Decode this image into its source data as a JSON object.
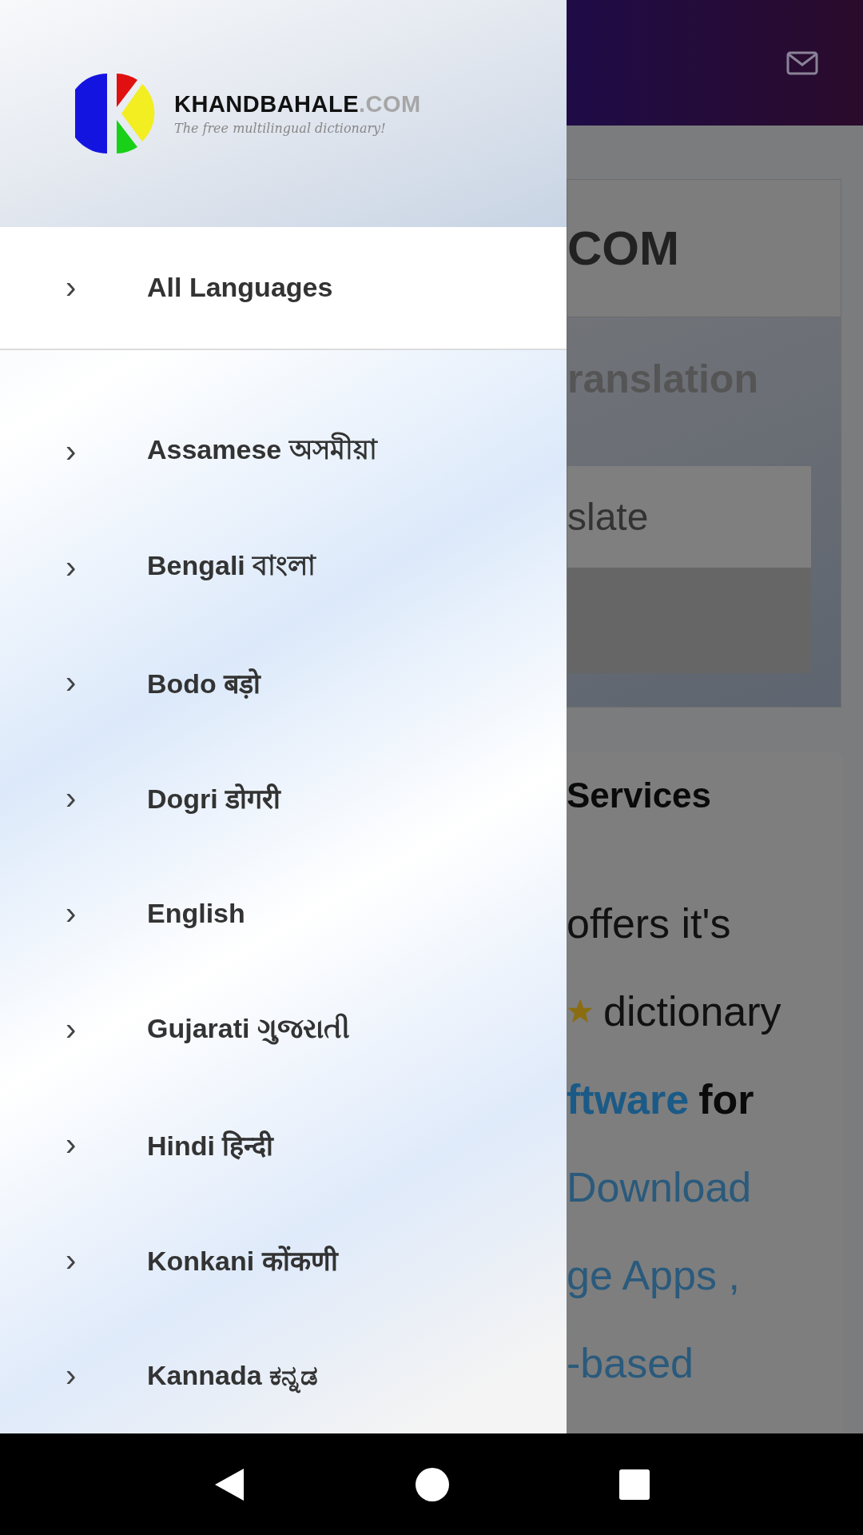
{
  "drawer": {
    "logo": {
      "name": "KHANDBAHALE",
      "suffix": ".COM",
      "tagline": "The free multilingual dictionary!"
    },
    "top_item": {
      "label": "All Languages",
      "chevron": "›"
    },
    "items": [
      {
        "label": "Assamese অসমীয়া",
        "chevron": "›"
      },
      {
        "label": "Bengali বাংলা",
        "chevron": "›"
      },
      {
        "label": "Bodo बड़ो",
        "chevron": "›"
      },
      {
        "label": "Dogri डोगरी",
        "chevron": "›"
      },
      {
        "label": "English",
        "chevron": "›"
      },
      {
        "label": "Gujarati ગુજરાતી",
        "chevron": "›"
      },
      {
        "label": "Hindi हिन्दी",
        "chevron": "›"
      },
      {
        "label": "Konkani कोंकणी",
        "chevron": "›"
      },
      {
        "label": "Kannada ಕನ್ನಡ",
        "chevron": "›"
      }
    ]
  },
  "page": {
    "card_title": "COM",
    "section_title": "ranslation",
    "input_value": "slate",
    "services_title": "Services",
    "lines": [
      {
        "kind": "plain",
        "text": "offers it's"
      },
      {
        "kind": "star",
        "text": "dictionary"
      },
      {
        "kind": "bold",
        "text": "ftware",
        "extra": "for"
      },
      {
        "kind": "link",
        "text": "Download"
      },
      {
        "kind": "link",
        "text": "ge Apps ,"
      },
      {
        "kind": "link",
        "text": "-based"
      }
    ]
  }
}
